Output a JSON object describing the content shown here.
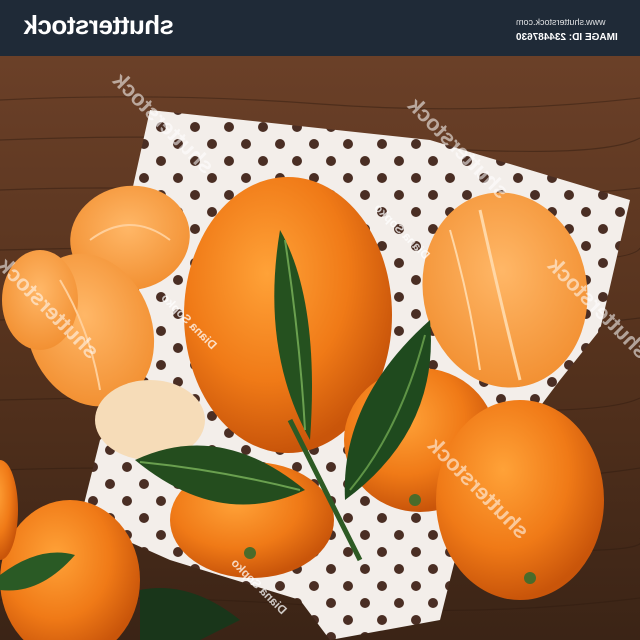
{
  "header": {
    "brand": "shutterstock",
    "site": "www.shutterstock.com",
    "image_id": "IMAGE ID: 234487630"
  },
  "watermark": {
    "text": "shutterstock",
    "credit": "Diana Sopko"
  },
  "colors": {
    "header_bg": "#1f2a37",
    "wood": "#5a3520",
    "orange": "#f07a17",
    "leaf": "#1f4a1e",
    "cloth": "#f3eeea"
  }
}
